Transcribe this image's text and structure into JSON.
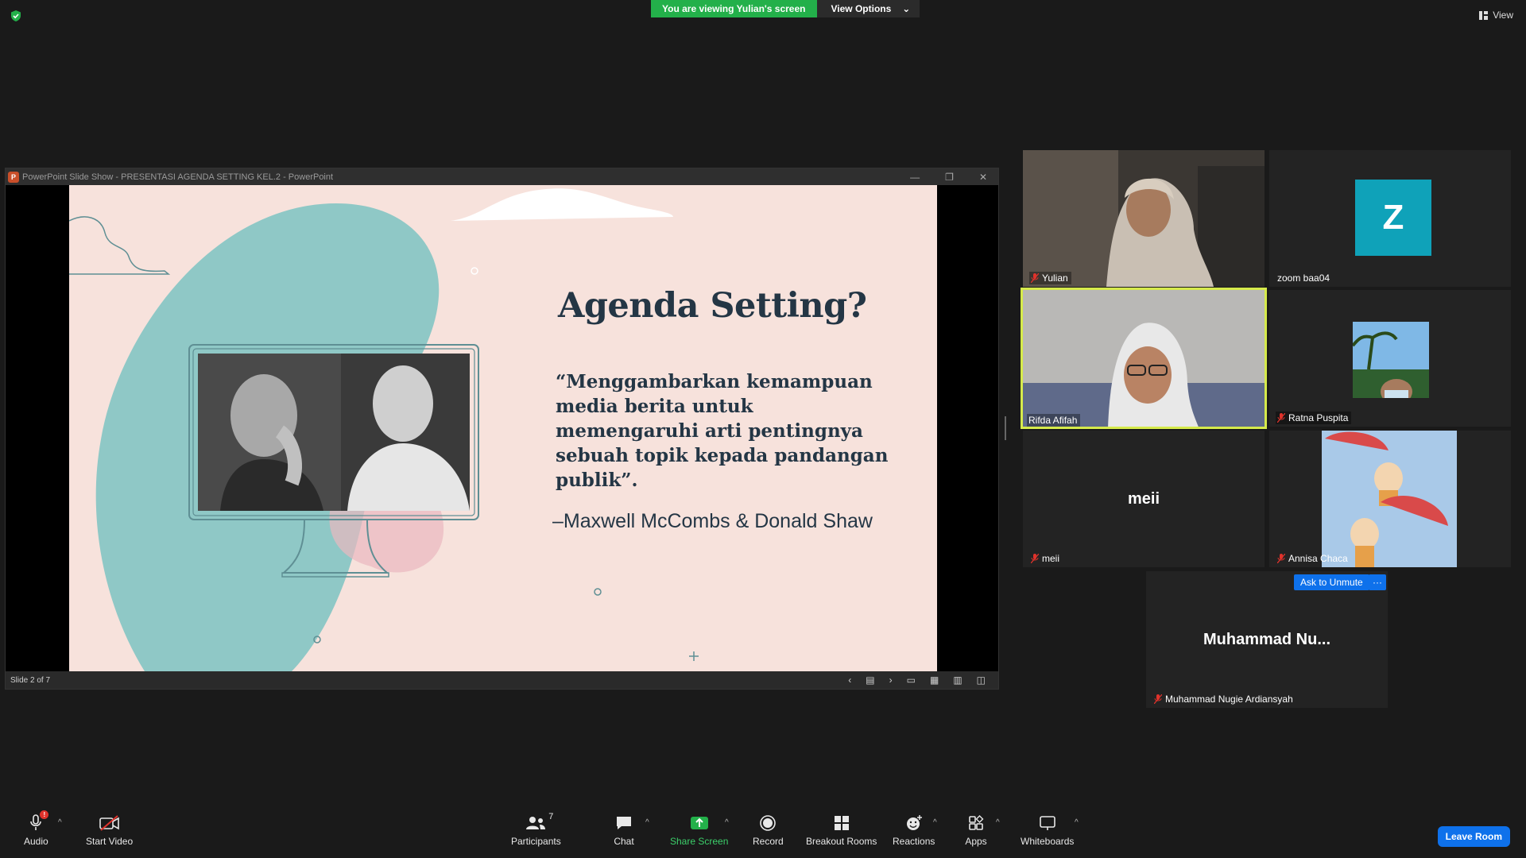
{
  "top_bar": {
    "viewing_label": "You are viewing Yulian's screen",
    "view_options_label": "View Options",
    "view_label": "View"
  },
  "ppt": {
    "window_title": "PowerPoint Slide Show  -  PRESENTASI AGENDA SETTING KEL.2  -  PowerPoint",
    "slide_status": "Slide 2 of 7",
    "slide": {
      "title": "Agenda Setting?",
      "quote": "“Menggambarkan kemampuan media berita untuk memengaruhi arti pentingnya sebuah topik kepada pandangan publik”.",
      "author": "–Maxwell McCombs & Donald Shaw"
    }
  },
  "gallery": {
    "tiles": [
      {
        "name": "Yulian",
        "muted": true
      },
      {
        "name": "zoom baa04",
        "muted": false,
        "avatar_letter": "Z"
      },
      {
        "name": "Rifda Afifah",
        "muted": false,
        "active": true
      },
      {
        "name": "Ratna Puspita",
        "muted": true
      },
      {
        "name": "meii",
        "muted": true,
        "center_label": "meii"
      },
      {
        "name": "Annisa Chaca",
        "muted": true
      },
      {
        "name": "Muhammad Nugie Ardiansyah",
        "muted": true,
        "center_label": "Muhammad  Nu..."
      }
    ],
    "ask_unmute_label": "Ask to Unmute",
    "more_label": "···"
  },
  "toolbar": {
    "audio_label": "Audio",
    "start_video_label": "Start Video",
    "participants_label": "Participants",
    "participants_count": "7",
    "chat_label": "Chat",
    "share_screen_label": "Share Screen",
    "record_label": "Record",
    "breakout_label": "Breakout Rooms",
    "reactions_label": "Reactions",
    "apps_label": "Apps",
    "whiteboards_label": "Whiteboards",
    "leave_label": "Leave Room",
    "audio_badge": "!"
  },
  "colors": {
    "share_green": "#23b04a",
    "zoom_blue": "#0e71eb",
    "active_speaker": "#d6ea4b",
    "slide_bg": "#f7e2dc",
    "slide_text": "#243645",
    "teal_blob": "#8fc8c6"
  }
}
